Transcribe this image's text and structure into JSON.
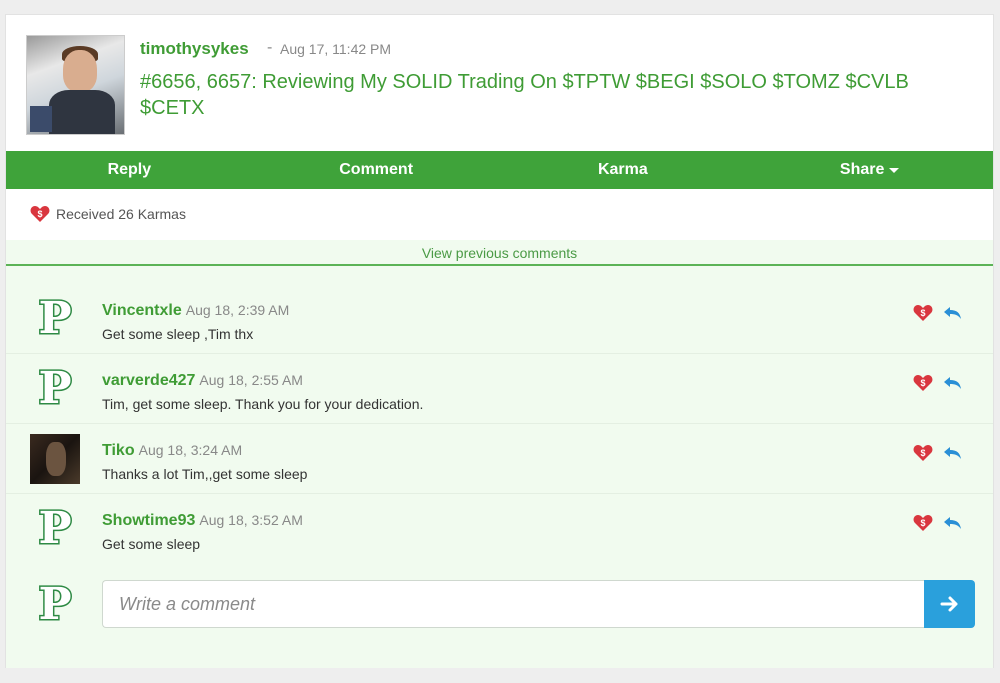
{
  "post": {
    "username": "timothysykes",
    "separator": "-",
    "timestamp": "Aug 17, 11:42 PM",
    "title": "#6656, 6657: Reviewing My SOLID Trading On $TPTW $BEGI $SOLO $TOMZ $CVLB $CETX",
    "avatar_icon": "magazine-cover-avatar"
  },
  "actions": {
    "reply": "Reply",
    "comment": "Comment",
    "karma": "Karma",
    "share": "Share"
  },
  "karma_summary": "Received 26 Karmas",
  "view_previous": "View previous comments",
  "comments": [
    {
      "username": "Vincentxle",
      "timestamp": "Aug 18, 2:39 AM",
      "text": "Get some sleep ,Tim thx",
      "avatar": "p-logo"
    },
    {
      "username": "varverde427",
      "timestamp": "Aug 18, 2:55 AM",
      "text": "Tim, get some sleep. Thank you for your dedication.",
      "avatar": "p-logo"
    },
    {
      "username": "Tiko",
      "timestamp": "Aug 18, 3:24 AM",
      "text": "Thanks a lot Tim,,get some sleep",
      "avatar": "photo"
    },
    {
      "username": "Showtime93",
      "timestamp": "Aug 18, 3:52 AM",
      "text": "Get some sleep",
      "avatar": "p-logo"
    }
  ],
  "composer": {
    "placeholder": "Write a comment",
    "avatar": "p-logo",
    "send_icon": "arrow-right-icon"
  },
  "colors": {
    "brand_green": "#3fa33a",
    "text_green": "#3f9c35",
    "karma_red": "#d9363e",
    "reply_blue": "#2a8fd6",
    "send_blue": "#2aa0dc",
    "comments_bg": "#f1fbef"
  },
  "p_logo_letter": "P"
}
